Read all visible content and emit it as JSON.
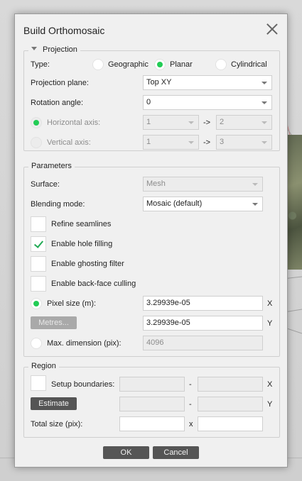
{
  "dialog": {
    "title": "Build Orthomosaic"
  },
  "projection": {
    "legend": "Projection",
    "type_label": "Type:",
    "types": [
      "Geographic",
      "Planar",
      "Cylindrical"
    ],
    "selected_type": "Planar",
    "plane_label": "Projection plane:",
    "plane_value": "Top XY",
    "rotation_label": "Rotation angle:",
    "rotation_value": "0",
    "horizontal_label": "Horizontal axis:",
    "horizontal_from": "1",
    "horizontal_to": "2",
    "vertical_label": "Vertical axis:",
    "vertical_from": "1",
    "vertical_to": "3",
    "arrow": "->"
  },
  "parameters": {
    "legend": "Parameters",
    "surface_label": "Surface:",
    "surface_value": "Mesh",
    "blending_label": "Blending mode:",
    "blending_value": "Mosaic (default)",
    "refine_label": "Refine seamlines",
    "refine_checked": false,
    "hole_label": "Enable hole filling",
    "hole_checked": true,
    "ghost_label": "Enable ghosting filter",
    "ghost_checked": false,
    "backface_label": "Enable back-face culling",
    "backface_checked": false,
    "pixel_label": "Pixel size (m):",
    "pixel_x": "3.29939e-05",
    "pixel_y": "3.29939e-05",
    "x_label": "X",
    "y_label": "Y",
    "metres_button": "Metres...",
    "maxdim_label": "Max. dimension (pix):",
    "maxdim_value": "4096"
  },
  "region": {
    "legend": "Region",
    "setup_label": "Setup boundaries:",
    "dash": "-",
    "x_label": "X",
    "y_label": "Y",
    "estimate_button": "Estimate",
    "total_label": "Total size (pix):",
    "times": "x"
  },
  "buttons": {
    "ok": "OK",
    "cancel": "Cancel"
  },
  "colors": {
    "accent": "#22cc55",
    "button": "#555555"
  }
}
